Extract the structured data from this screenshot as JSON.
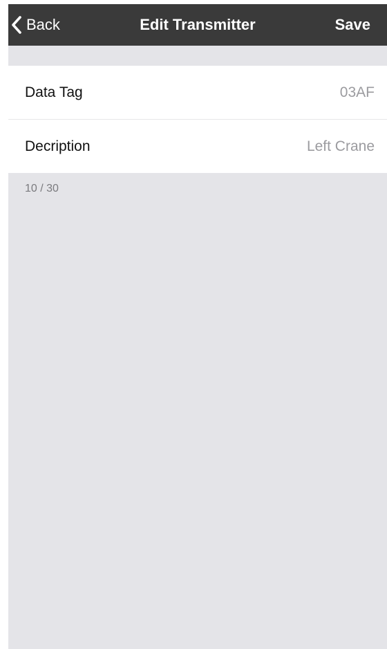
{
  "navbar": {
    "back_label": "Back",
    "title": "Edit Transmitter",
    "save_label": "Save",
    "back_icon": "chevron-left-icon",
    "background_color": "#3a3a3a"
  },
  "form": {
    "data_tag": {
      "label": "Data Tag",
      "value": "03AF"
    },
    "description": {
      "label": "Decription",
      "value": "Left Crane"
    },
    "char_count": "10 / 30"
  },
  "colors": {
    "background": "#e4e4e8",
    "value_text": "#9b9b9f"
  }
}
